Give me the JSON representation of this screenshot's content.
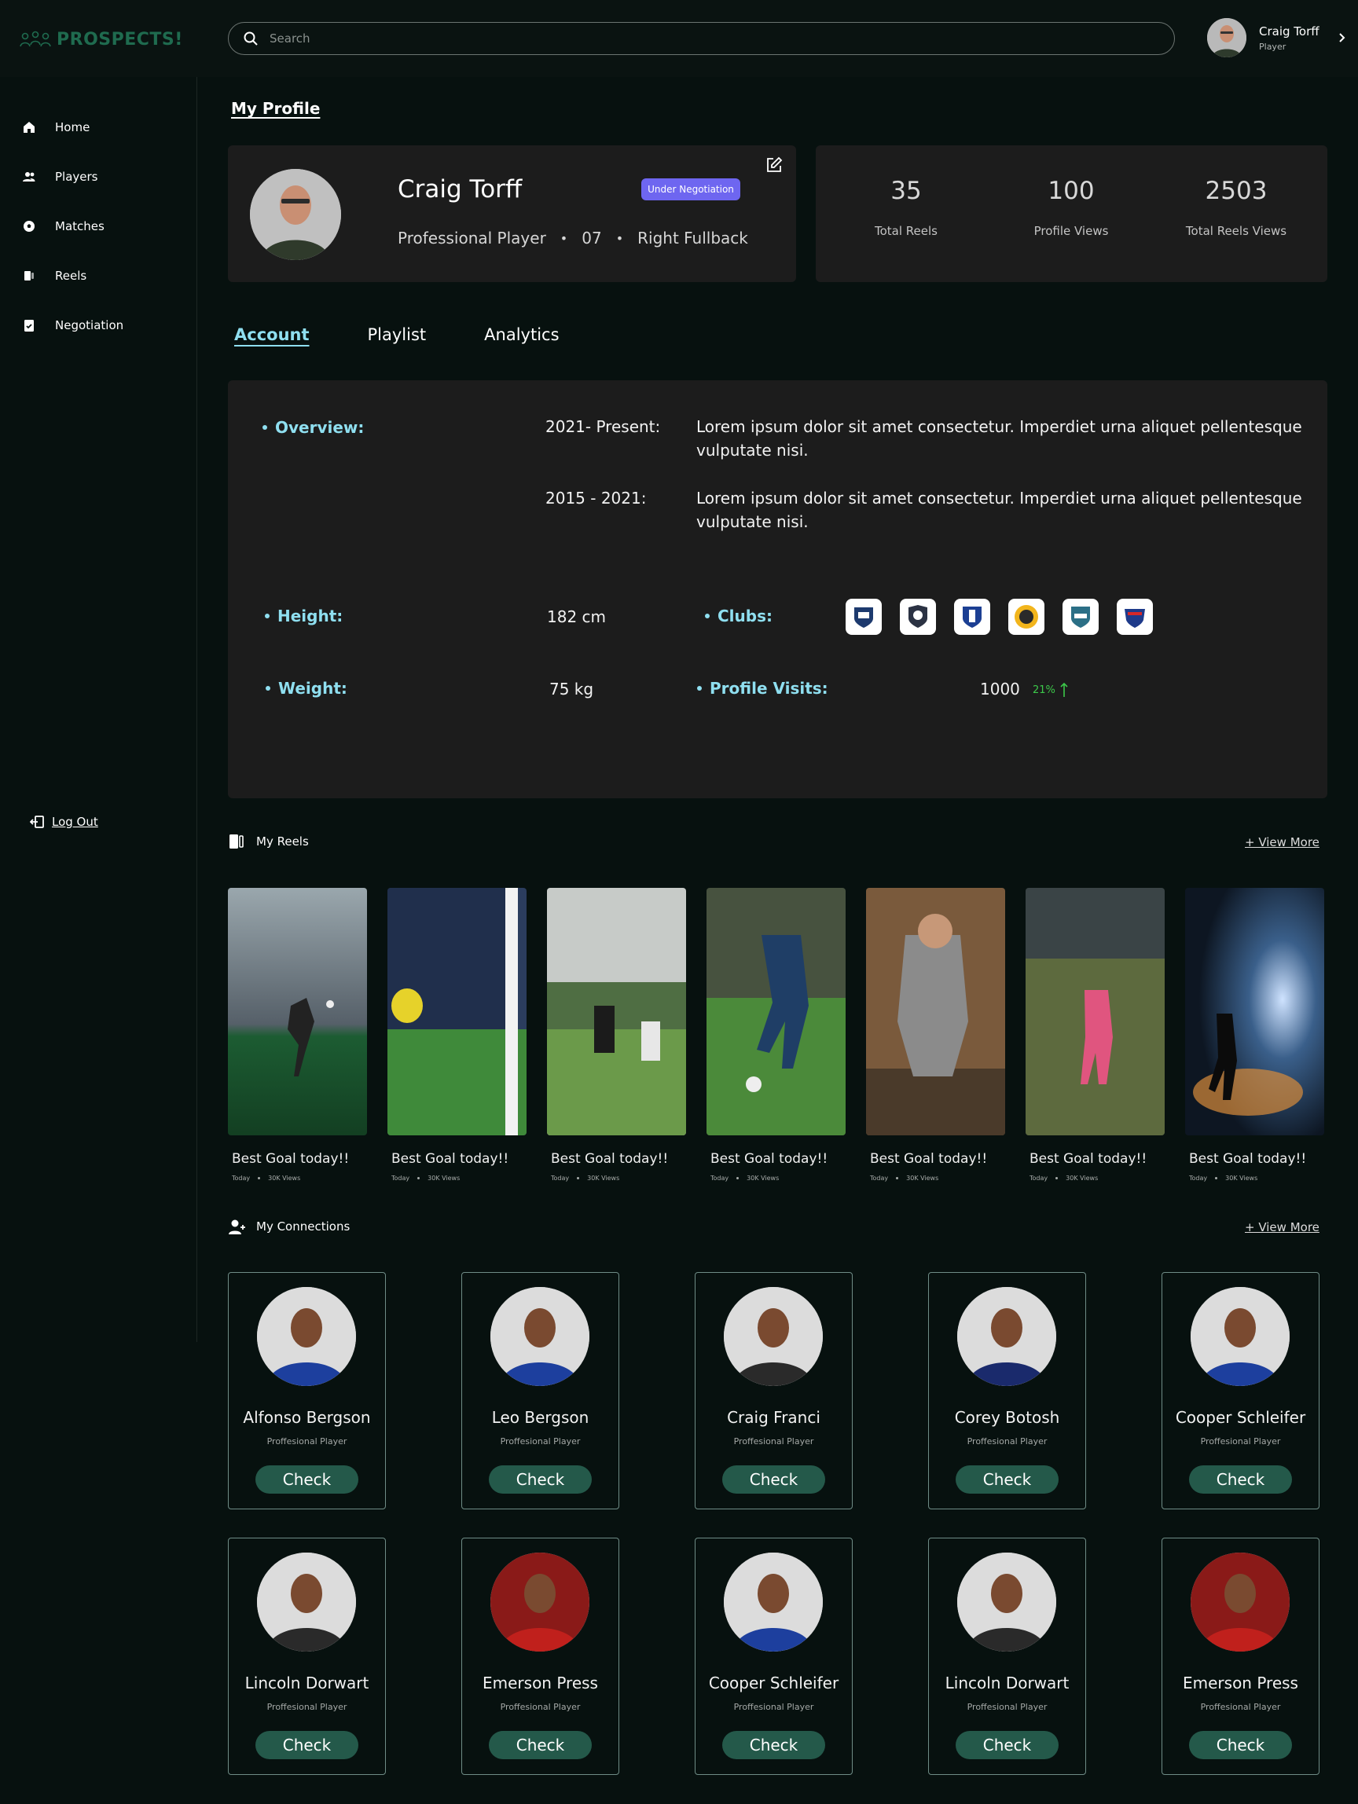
{
  "brand": {
    "logo_text": "PROSPECTS!",
    "accent": "#1f6b4f"
  },
  "search": {
    "placeholder": "Search"
  },
  "user": {
    "name": "Craig Torff",
    "role": "Player"
  },
  "sidebar": {
    "items": [
      {
        "label": "Home",
        "icon": "home-icon"
      },
      {
        "label": "Players",
        "icon": "users-icon"
      },
      {
        "label": "Matches",
        "icon": "ball-icon"
      },
      {
        "label": "Reels",
        "icon": "reel-icon"
      },
      {
        "label": "Negotiation",
        "icon": "clipboard-icon"
      }
    ],
    "logout": "Log Out"
  },
  "page": {
    "title": "My Profile"
  },
  "profile": {
    "name": "Craig Torff",
    "badge": "Under Negotiation",
    "role": "Professional  Player",
    "number": "07",
    "position": "Right Fullback",
    "badge_color": "#6e66f0"
  },
  "stats": [
    {
      "value": "35",
      "label": "Total Reels"
    },
    {
      "value": "100",
      "label": "Profile Views"
    },
    {
      "value": "2503",
      "label": "Total Reels Views"
    }
  ],
  "tabs": [
    {
      "label": "Account",
      "active": true
    },
    {
      "label": "Playlist",
      "active": false
    },
    {
      "label": "Analytics",
      "active": false
    }
  ],
  "account": {
    "overview_label": "Overview:",
    "history": [
      {
        "period": "2021- Present:",
        "text": "Lorem ipsum dolor sit amet consectetur. Imperdiet urna aliquet pellentesque vulputate nisi."
      },
      {
        "period": "2015 - 2021:",
        "text": "Lorem ipsum dolor sit amet consectetur. Imperdiet urna aliquet pellentesque vulputate nisi."
      }
    ],
    "height_label": "Height:",
    "height": "182 cm",
    "weight_label": "Weight:",
    "weight": "75 kg",
    "clubs_label": "Clubs:",
    "clubs_count": 6,
    "visits_label": "Profile Visits:",
    "visits": "1000",
    "visits_change": "21%",
    "visits_change_color": "#3cc84a"
  },
  "reels_section": {
    "title": "My Reels",
    "view_more": "+ View More",
    "items": [
      {
        "title": "Best Goal today!!",
        "when": "Today",
        "views": "30K Views"
      },
      {
        "title": "Best Goal today!!",
        "when": "Today",
        "views": "30K Views"
      },
      {
        "title": "Best Goal today!!",
        "when": "Today",
        "views": "30K Views"
      },
      {
        "title": "Best Goal today!!",
        "when": "Today",
        "views": "30K Views"
      },
      {
        "title": "Best Goal today!!",
        "when": "Today",
        "views": "30K Views"
      },
      {
        "title": "Best Goal today!!",
        "when": "Today",
        "views": "30K Views"
      },
      {
        "title": "Best Goal today!!",
        "when": "Today",
        "views": "30K Views"
      }
    ]
  },
  "connections_section": {
    "title": "My Connections",
    "view_more": "+ View More",
    "items": [
      {
        "name": "Alfonso Bergson",
        "role": "Proffesional Player",
        "button": "Check",
        "kit": "#1d3f9e"
      },
      {
        "name": "Leo Bergson",
        "role": "Proffesional Player",
        "button": "Check",
        "kit": "#1d3f9e"
      },
      {
        "name": "Craig Franci",
        "role": "Proffesional Player",
        "button": "Check",
        "kit": "#2a2a2a"
      },
      {
        "name": "Corey Botosh",
        "role": "Proffesional Player",
        "button": "Check",
        "kit": "#1a2a6c"
      },
      {
        "name": "Cooper Schleifer",
        "role": "Proffesional Player",
        "button": "Check",
        "kit": "#1d3f9e"
      },
      {
        "name": "Lincoln Dorwart",
        "role": "Proffesional Player",
        "button": "Check",
        "kit": "#2a2a2a"
      },
      {
        "name": "Emerson Press",
        "role": "Proffesional Player",
        "button": "Check",
        "kit": "#c0201c"
      },
      {
        "name": "Cooper Schleifer",
        "role": "Proffesional Player",
        "button": "Check",
        "kit": "#1d3f9e"
      },
      {
        "name": "Lincoln Dorwart",
        "role": "Proffesional Player",
        "button": "Check",
        "kit": "#2a2a2a"
      },
      {
        "name": "Emerson Press",
        "role": "Proffesional Player",
        "button": "Check",
        "kit": "#c0201c"
      }
    ]
  }
}
